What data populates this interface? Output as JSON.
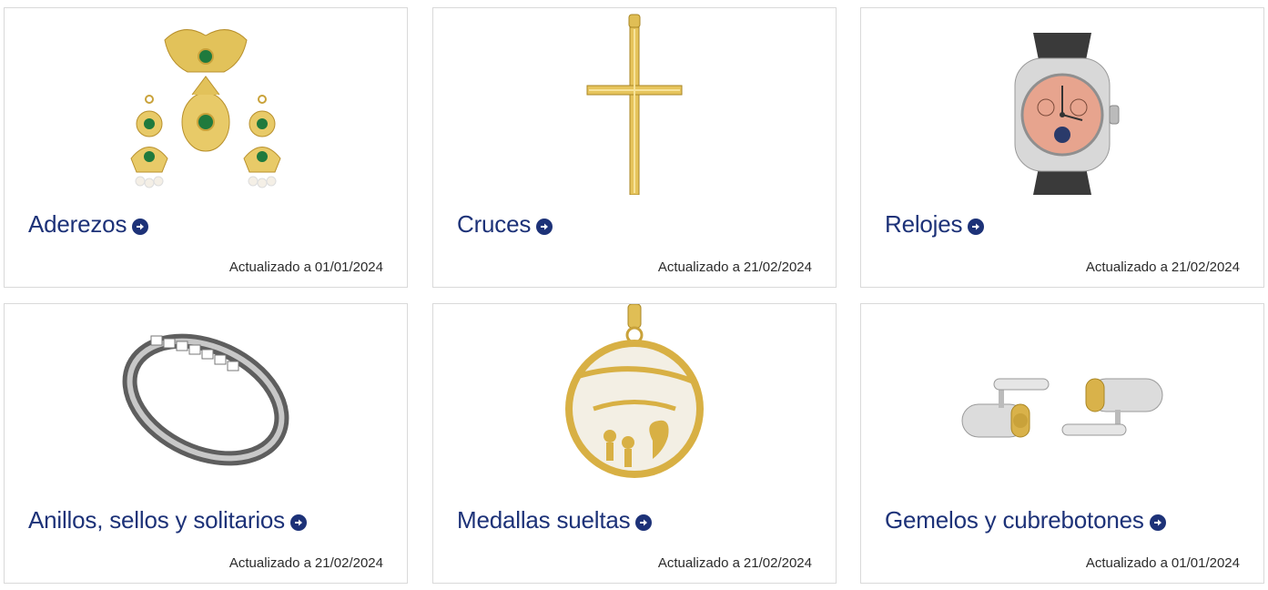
{
  "updated_prefix": "Actualizado a",
  "cards": [
    {
      "title": "Aderezos",
      "date": "01/01/2024",
      "image": "jewelry-set-image"
    },
    {
      "title": "Cruces",
      "date": "21/02/2024",
      "image": "gold-cross-image"
    },
    {
      "title": "Relojes",
      "date": "21/02/2024",
      "image": "watch-image"
    },
    {
      "title": "Anillos, sellos y solitarios",
      "date": "21/02/2024",
      "image": "ring-image"
    },
    {
      "title": "Medallas sueltas",
      "date": "21/02/2024",
      "image": "medal-image"
    },
    {
      "title": "Gemelos y cubrebotones",
      "date": "01/01/2024",
      "image": "cufflinks-image"
    }
  ],
  "colors": {
    "title": "#1d3278",
    "border": "#d9d9d9",
    "gold": "#d9b24a"
  },
  "icons": {
    "arrow": "arrow-circle-right-icon"
  }
}
